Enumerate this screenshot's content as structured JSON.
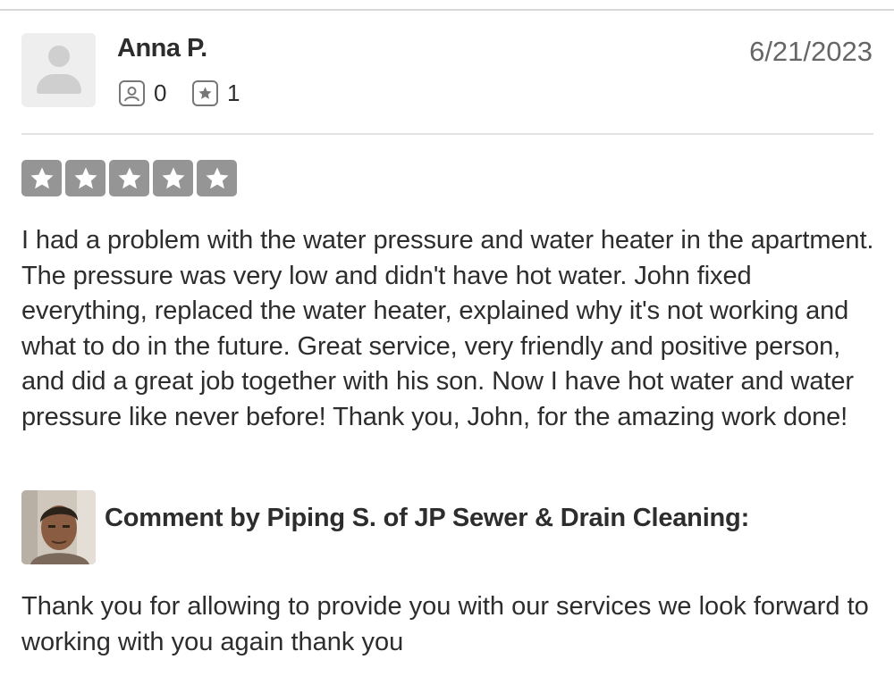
{
  "review": {
    "user_name": "Anna P.",
    "date": "6/21/2023",
    "friend_count": "0",
    "review_count": "1",
    "rating": 5,
    "rating_max": 5,
    "text": "I had a problem with the water pressure and water heater in the apartment. The pressure was very low and didn't have hot water. John fixed everything, replaced the water heater, explained why it's not working and what to do in the future. Great service, very friendly and positive person, and did a great job together with his son. Now I have hot water and water pressure like never before! Thank you, John, for the amazing work done!"
  },
  "owner_comment": {
    "heading": "Comment by Piping S. of JP Sewer & Drain Cleaning:",
    "text": "Thank you for allowing to provide you with our services we look forward to working with you again thank you"
  },
  "colors": {
    "star_fill": "#959595",
    "text": "#2d2d2d",
    "muted": "#666666"
  },
  "icons": {
    "avatar": "default-user-avatar-icon",
    "friends": "friends-icon",
    "reviews": "review-star-icon",
    "rating_star": "star-icon"
  }
}
